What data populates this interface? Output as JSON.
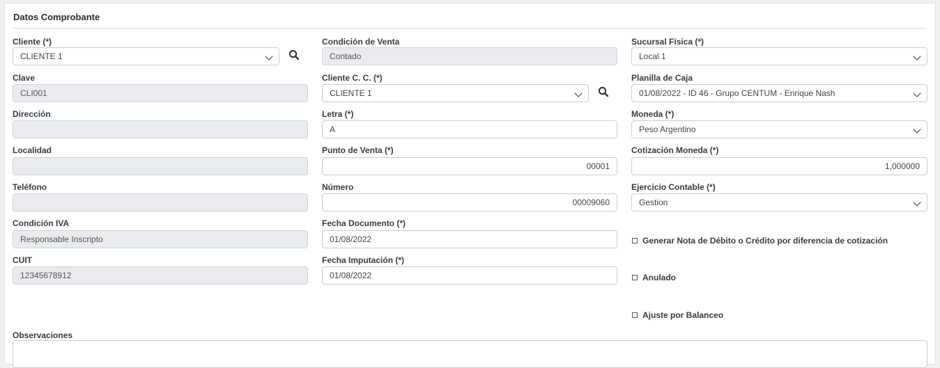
{
  "panel": {
    "title": "Datos Comprobante"
  },
  "left": {
    "cliente": {
      "label": "Cliente (*)",
      "value": "CLIENTE 1"
    },
    "clave": {
      "label": "Clave",
      "value": "CLI001"
    },
    "direccion": {
      "label": "Dirección",
      "value": ""
    },
    "localidad": {
      "label": "Localidad",
      "value": ""
    },
    "telefono": {
      "label": "Teléfono",
      "value": ""
    },
    "condicion_iva": {
      "label": "Condición IVA",
      "value": "Responsable Inscripto"
    },
    "cuit": {
      "label": "CUIT",
      "value": "12345678912"
    }
  },
  "middle": {
    "condicion_venta": {
      "label": "Condición de Venta",
      "value": "Contado"
    },
    "cliente_cc": {
      "label": "Cliente C. C. (*)",
      "value": "CLIENTE 1"
    },
    "letra": {
      "label": "Letra (*)",
      "value": "A"
    },
    "punto_venta": {
      "label": "Punto de Venta (*)",
      "value": "00001"
    },
    "numero": {
      "label": "Número",
      "value": "00009060"
    },
    "fecha_documento": {
      "label": "Fecha Documento (*)",
      "value": "01/08/2022"
    },
    "fecha_imputacion": {
      "label": "Fecha Imputación (*)",
      "value": "01/08/2022"
    }
  },
  "right": {
    "sucursal": {
      "label": "Sucursal Física (*)",
      "value": "Local 1"
    },
    "planilla": {
      "label": "Planilla de Caja",
      "value": "01/08/2022 - ID 46 - Grupo CENTUM - Enrique Nash"
    },
    "moneda": {
      "label": "Moneda (*)",
      "value": "Peso Argentino"
    },
    "cotizacion": {
      "label": "Cotización Moneda (*)",
      "value": "1,000000"
    },
    "ejercicio": {
      "label": "Ejercicio Contable (*)",
      "value": "Gestion"
    },
    "chk_nota": {
      "label": "Generar Nota de Débito o Crédito por diferencia de cotización",
      "checked": false
    },
    "chk_anulado": {
      "label": "Anulado",
      "checked": false
    },
    "chk_ajuste": {
      "label": "Ajuste por Balanceo",
      "checked": false
    }
  },
  "observaciones": {
    "label": "Observaciones",
    "value": ""
  }
}
